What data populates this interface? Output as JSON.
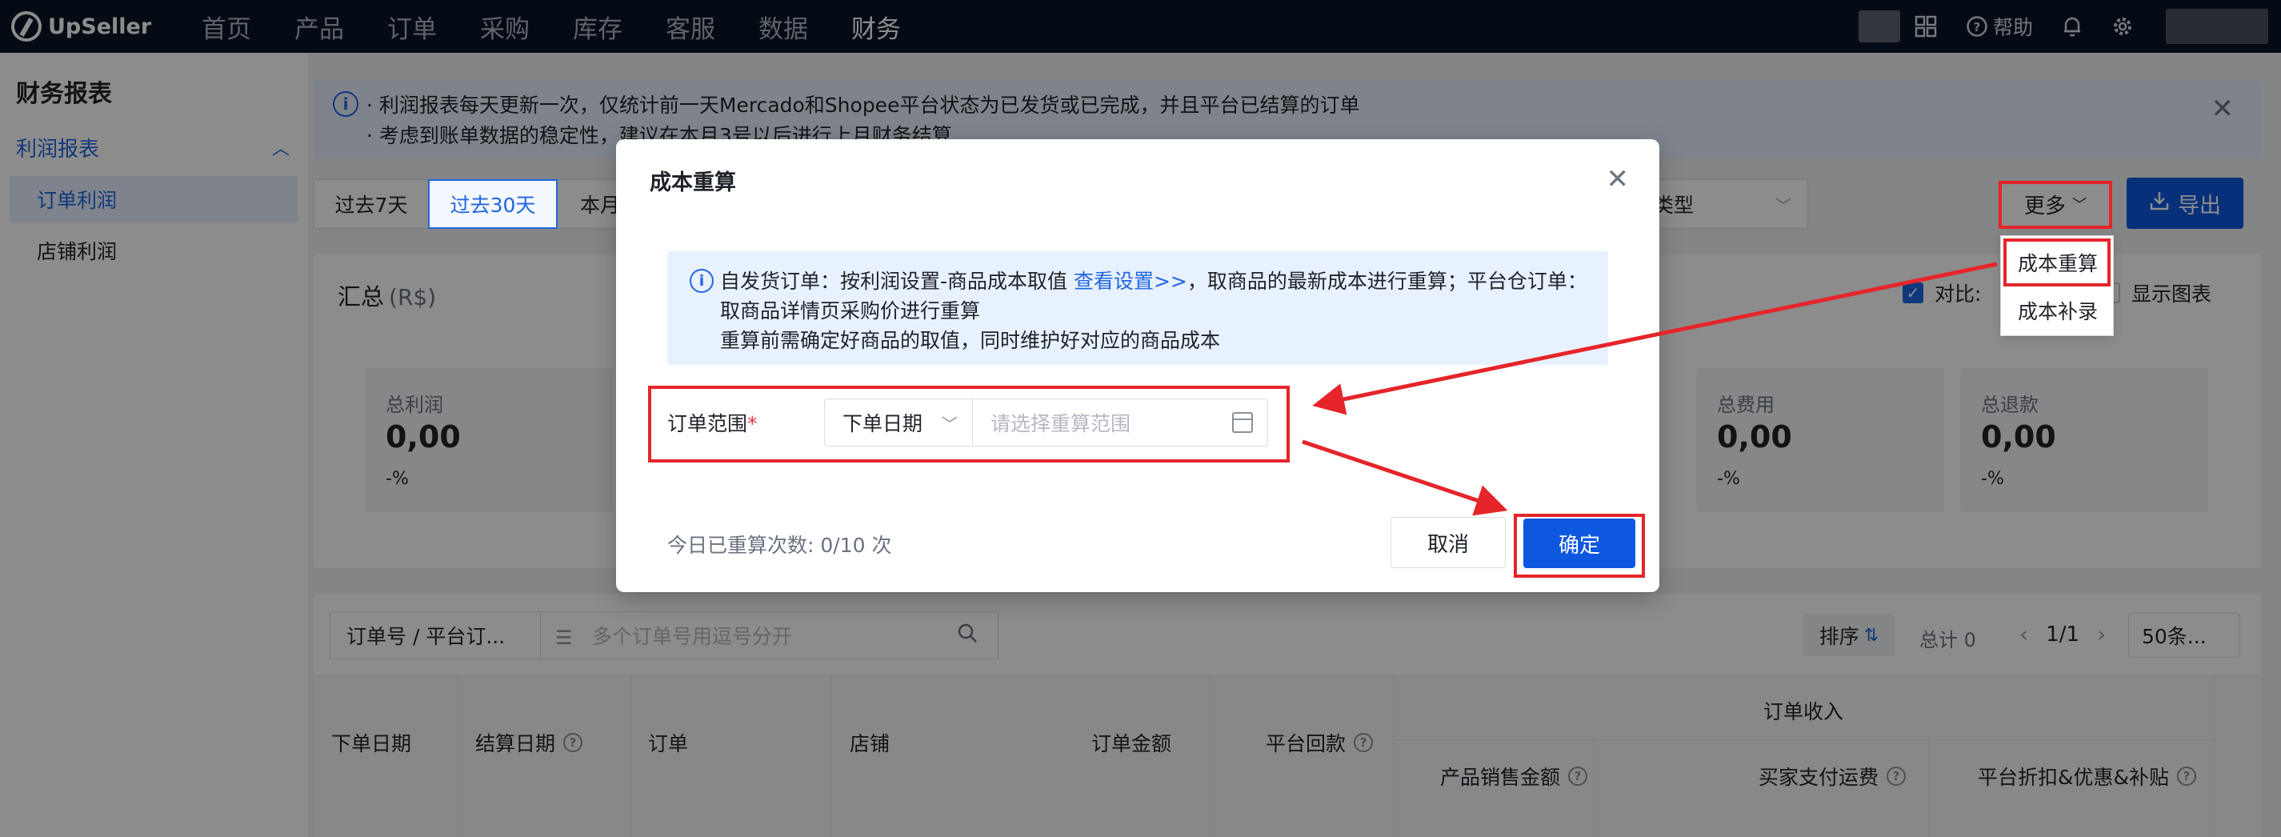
{
  "brand": {
    "name": "UpSeller"
  },
  "nav": {
    "items": [
      "首页",
      "产品",
      "订单",
      "采购",
      "库存",
      "客服",
      "数据",
      "财务"
    ],
    "active_index": 7,
    "help_label": "帮助"
  },
  "sidebar": {
    "title": "财务报表",
    "group_label": "利润报表",
    "items": [
      "订单利润",
      "店铺利润"
    ]
  },
  "notice": {
    "line1": "· 利润报表每天更新一次，仅统计前一天Mercado和Shopee平台状态为已发货或已完成，并且平台已结算的订单",
    "line2": "· 考虑到账单数据的稳定性，建议在本月3号以后进行上月财务结算"
  },
  "filters": {
    "date_options": [
      "过去7天",
      "过去30天",
      "本月"
    ],
    "active_date": "过去30天",
    "type_label": "类型",
    "more_label": "更多",
    "export_label": "导出",
    "more_menu": [
      "成本重算",
      "成本补录"
    ]
  },
  "summary": {
    "title": "汇总",
    "unit": "(R$)",
    "compare_label": "对比:",
    "show_chart_label": "显示图表",
    "cards": [
      {
        "label": "总利润",
        "value": "0,00",
        "pct": "-%"
      },
      {
        "label": "总费用",
        "value": "0,00",
        "pct": "-%"
      },
      {
        "label": "总退款",
        "value": "0,00",
        "pct": "-%"
      }
    ]
  },
  "table": {
    "search_type": "订单号 / 平台订...",
    "search_placeholder": "多个订单号用逗号分开",
    "sort_label": "排序",
    "total_text": "总计 0",
    "page_text": "1/1",
    "page_size": "50条...",
    "columns": [
      "下单日期",
      "结算日期",
      "订单",
      "店铺",
      "订单金额",
      "平台回款"
    ],
    "group_header": "订单收入",
    "sub_columns": [
      "产品销售金额",
      "买家支付运费",
      "平台折扣&优惠&补贴"
    ]
  },
  "dialog": {
    "title": "成本重算",
    "info_line1_prefix": "自发货订单：按利润设置-商品成本取值 ",
    "info_link": "查看设置>>",
    "info_line1_suffix": "，取商品的最新成本进行重算；平台仓订单：",
    "info_line2": "取商品详情页采购价进行重算",
    "info_line3": "重算前需确定好商品的取值，同时维护好对应的商品成本",
    "range_label": "订单范围",
    "required_mark": "*",
    "range_type": "下单日期",
    "range_placeholder": "请选择重算范围",
    "count_text": "今日已重算次数: 0/10 次",
    "cancel_label": "取消",
    "ok_label": "确定"
  },
  "colors": {
    "primary": "#0e58e0",
    "link": "#2066e0",
    "annotation_red": "#e5252a",
    "nav_bg": "#0a1527"
  }
}
